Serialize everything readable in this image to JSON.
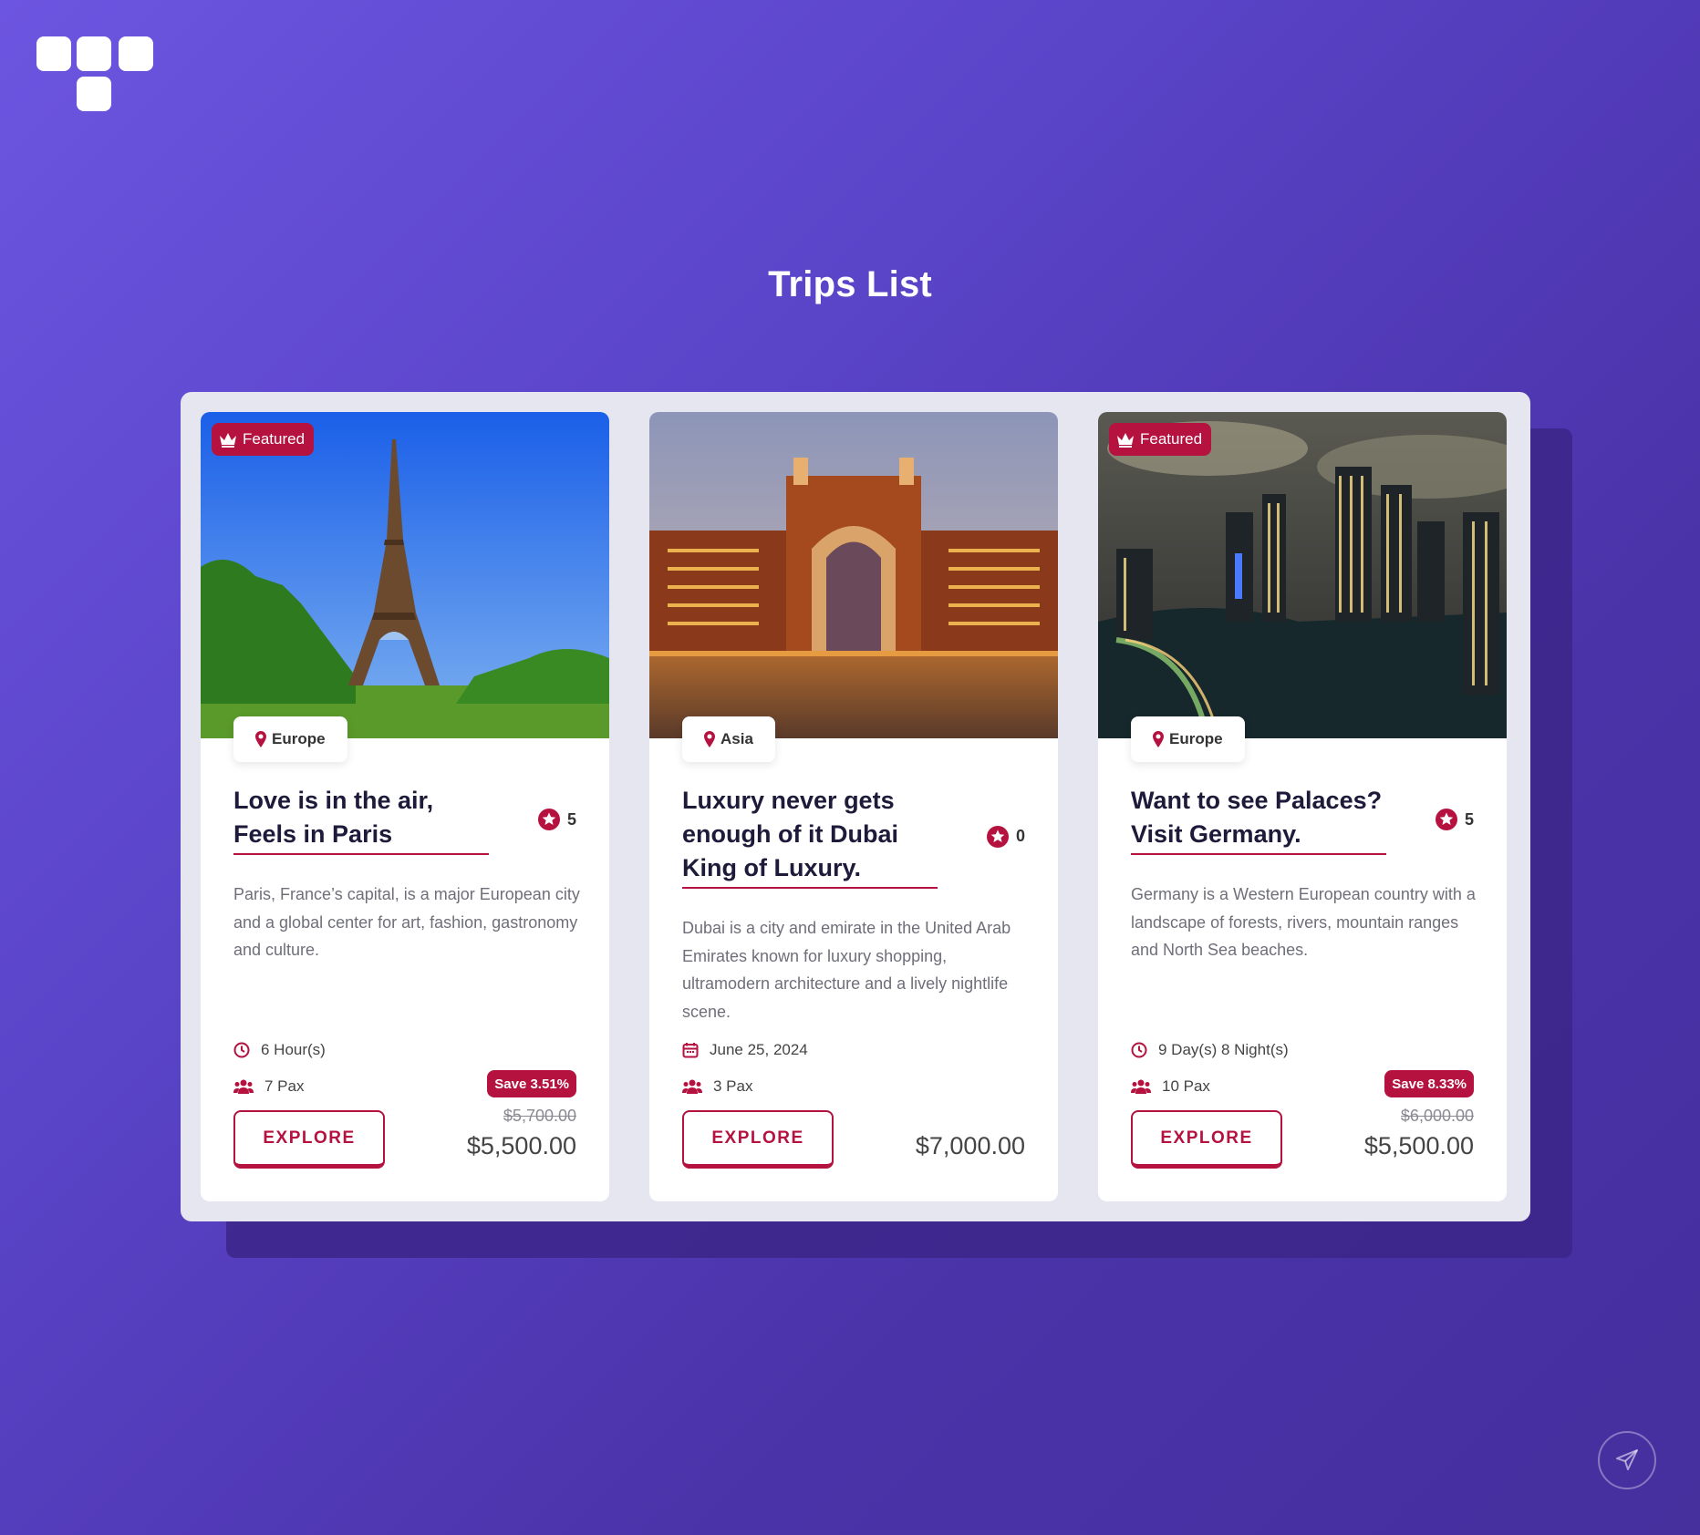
{
  "page": {
    "title": "Trips List"
  },
  "colors": {
    "accent": "#b5123f",
    "background_start": "#6c55e0",
    "background_end": "#45309e",
    "title_text": "#1d1a3a"
  },
  "icons": {
    "logo": "grid-logo-icon",
    "featured": "crown-icon",
    "location": "map-pin-icon",
    "rating": "star-circle-icon",
    "duration": "clock-icon",
    "date": "calendar-icon",
    "pax": "users-icon",
    "send": "paper-plane-icon"
  },
  "trips": [
    {
      "featured": "Featured",
      "location": "Europe",
      "title": "Love is in the air, Feels in Paris",
      "rating": "5",
      "description": "Paris, France’s capital, is a major European city and a global center for art, fashion, gastronomy and culture.",
      "duration": "6 Hour(s)",
      "pax": "7 Pax",
      "save": "Save 3.51%",
      "old_price": "$5,700.00",
      "price": "$5,500.00",
      "button": "EXPLORE"
    },
    {
      "location": "Asia",
      "title": "Luxury never gets enough of it Dubai King of Luxury.",
      "rating": "0",
      "description": "Dubai is a city and emirate in the United Arab Emirates known for luxury shopping, ultramodern architecture and a lively nightlife scene.",
      "date": "June 25, 2024",
      "pax": "3 Pax",
      "price": "$7,000.00",
      "button": "EXPLORE"
    },
    {
      "featured": "Featured",
      "location": "Europe",
      "title": "Want to see Palaces? Visit Germany.",
      "rating": "5",
      "description": "Germany is a Western European country with a landscape of forests, rivers, mountain ranges and North Sea beaches.",
      "duration": "9 Day(s) 8 Night(s)",
      "pax": "10 Pax",
      "save": "Save 8.33%",
      "old_price": "$6,000.00",
      "price": "$5,500.00",
      "button": "EXPLORE"
    }
  ]
}
